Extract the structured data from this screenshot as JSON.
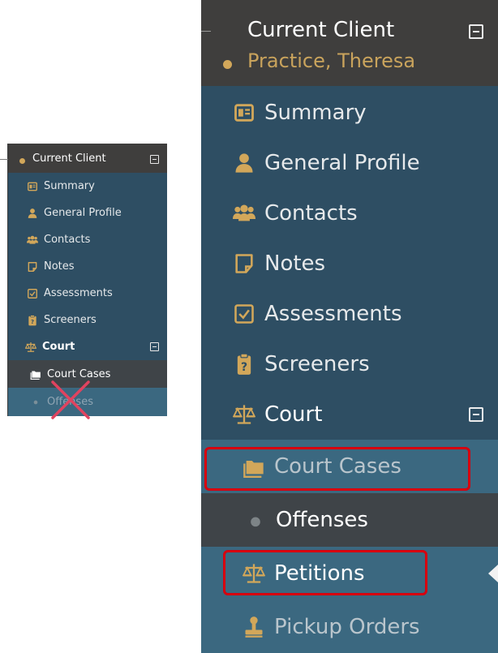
{
  "small_menu": {
    "header": {
      "title": "Current Client"
    },
    "items": [
      {
        "label": "Summary",
        "icon": "summary-icon"
      },
      {
        "label": "General Profile",
        "icon": "person-icon"
      },
      {
        "label": "Contacts",
        "icon": "contacts-icon"
      },
      {
        "label": "Notes",
        "icon": "note-icon"
      },
      {
        "label": "Assessments",
        "icon": "checkbox-icon"
      },
      {
        "label": "Screeners",
        "icon": "clipboard-icon"
      },
      {
        "label": "Court",
        "icon": "scales-icon"
      },
      {
        "label": "Court Cases",
        "icon": "folder-icon"
      },
      {
        "label": "Offenses",
        "icon": "dot-icon"
      }
    ]
  },
  "big_menu": {
    "header": {
      "title": "Current Client",
      "client_name": "Practice, Theresa"
    },
    "items": [
      {
        "label": "Summary",
        "icon": "summary-icon"
      },
      {
        "label": "General Profile",
        "icon": "person-icon"
      },
      {
        "label": "Contacts",
        "icon": "contacts-icon"
      },
      {
        "label": "Notes",
        "icon": "note-icon"
      },
      {
        "label": "Assessments",
        "icon": "checkbox-icon"
      },
      {
        "label": "Screeners",
        "icon": "clipboard-icon"
      },
      {
        "label": "Court",
        "icon": "scales-icon"
      },
      {
        "label": "Court Cases",
        "icon": "folder-icon"
      },
      {
        "label": "Offenses",
        "icon": "dot-icon"
      },
      {
        "label": "Petitions",
        "icon": "scales-icon"
      },
      {
        "label": "Pickup Orders",
        "icon": "stamp-icon"
      }
    ]
  },
  "colors": {
    "sidebar_bg": "#2e4e63",
    "header_bg": "#3f3e3d",
    "accent_gold": "#d2a75a",
    "highlight_red": "#d6000f",
    "cross_pink": "#e0435f"
  }
}
